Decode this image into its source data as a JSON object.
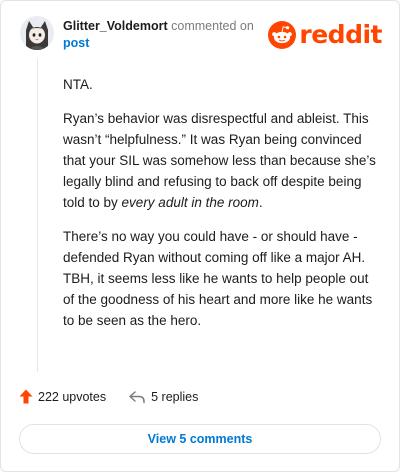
{
  "comment": {
    "username": "Glitter_Voldemort",
    "action_text": "commented on",
    "target_link": "post",
    "avatar_icon": "cat-avatar-icon",
    "paragraphs": {
      "p1": "NTA.",
      "p2": "Ryan’s behavior was disrespectful and ableist. This wasn’t “helpfulness.” It was Ryan being convinced that your SIL was somehow less than because she’s legally blind and refusing to back off despite being told to by ",
      "p2_emphasis": "every adult in the room",
      "p2_end": ".",
      "p3": "There’s no way you could have - or should have - defended Ryan without coming off like a major AH. TBH, it seems less like he wants to help people out of the goodness of his heart and more like he wants to be seen as the hero."
    }
  },
  "brand": {
    "name": "reddit",
    "icon": "reddit-snoo-icon",
    "color": "#ff4500"
  },
  "stats": {
    "upvotes": "222 upvotes",
    "replies": "5 replies",
    "upvote_icon": "upvote-arrow-icon",
    "reply_icon": "reply-arrow-icon",
    "upvote_color": "#ff4500"
  },
  "actions": {
    "view_comments": "View 5 comments"
  },
  "colors": {
    "link": "#0079d3",
    "muted": "#7c7c7c"
  }
}
